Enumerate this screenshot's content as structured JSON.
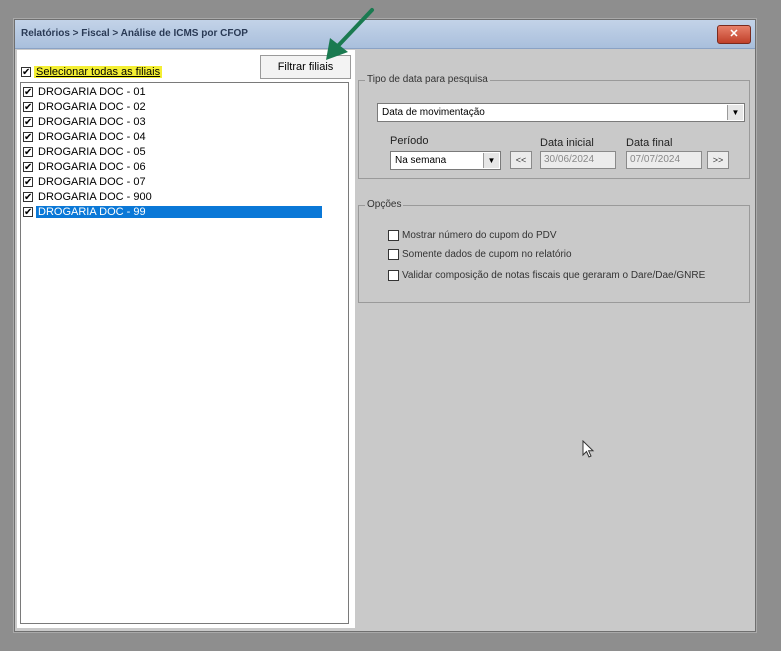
{
  "window": {
    "title": "Relatórios > Fiscal > Análise de ICMS por CFOP",
    "close_label": "✕"
  },
  "left": {
    "select_all_label": "Selecionar todas as filiais",
    "filter_button": "Filtrar filiais",
    "branches": [
      {
        "label": "DROGARIA DOC - 01",
        "checked": true
      },
      {
        "label": "DROGARIA DOC - 02",
        "checked": true
      },
      {
        "label": "DROGARIA DOC - 03",
        "checked": true
      },
      {
        "label": "DROGARIA DOC - 04",
        "checked": true
      },
      {
        "label": "DROGARIA DOC - 05",
        "checked": true
      },
      {
        "label": "DROGARIA DOC - 06",
        "checked": true
      },
      {
        "label": "DROGARIA DOC - 07",
        "checked": true
      },
      {
        "label": "DROGARIA DOC - 900",
        "checked": true
      },
      {
        "label": "DROGARIA DOC - 99",
        "checked": true,
        "selected": true
      }
    ]
  },
  "date_type": {
    "group_title": "Tipo de data para pesquisa",
    "selected": "Data de movimentação",
    "period_label": "Período",
    "period_value": "Na semana",
    "prev_label": "<<",
    "next_label": ">>",
    "start_label": "Data inicial",
    "start_value": "30/06/2024",
    "end_label": "Data final",
    "end_value": "07/07/2024"
  },
  "options": {
    "group_title": "Opções",
    "items": [
      "Mostrar número do cupom do PDV",
      "Somente dados de cupom no relatório",
      "Validar composição de notas fiscais  que geraram o Dare/Dae/GNRE"
    ]
  },
  "colors": {
    "selection": "#0a78d7",
    "highlight": "#f4ef33",
    "annotation_arrow": "#1a7a50"
  }
}
